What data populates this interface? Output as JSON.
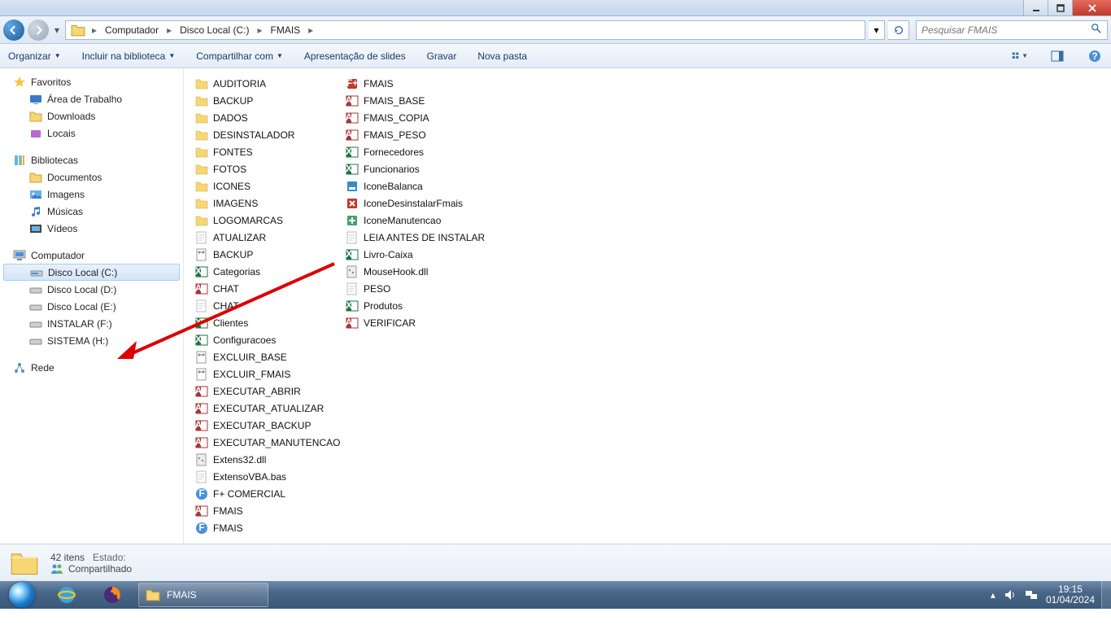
{
  "breadcrumb": {
    "p1": "Computador",
    "p2": "Disco Local (C:)",
    "p3": "FMAIS"
  },
  "search": {
    "placeholder": "Pesquisar FMAIS"
  },
  "toolbar": {
    "organize": "Organizar",
    "include": "Incluir na biblioteca",
    "share": "Compartilhar com",
    "slideshow": "Apresentação de slides",
    "burn": "Gravar",
    "newfolder": "Nova pasta"
  },
  "sidebar": {
    "fav": "Favoritos",
    "desktop": "Área de Trabalho",
    "downloads": "Downloads",
    "places": "Locais",
    "libs": "Bibliotecas",
    "docs": "Documentos",
    "imgs": "Imagens",
    "music": "Músicas",
    "videos": "Vídeos",
    "computer": "Computador",
    "c": "Disco Local (C:)",
    "d": "Disco Local (D:)",
    "e": "Disco Local (E:)",
    "f": "INSTALAR (F:)",
    "h": "SISTEMA (H:)",
    "network": "Rede"
  },
  "col1": [
    {
      "n": "AUDITORIA",
      "i": "folder"
    },
    {
      "n": "BACKUP",
      "i": "folder"
    },
    {
      "n": "DADOS",
      "i": "folder"
    },
    {
      "n": "DESINSTALADOR",
      "i": "folder"
    },
    {
      "n": "FONTES",
      "i": "folder"
    },
    {
      "n": "FOTOS",
      "i": "folder"
    },
    {
      "n": "ICONES",
      "i": "folder"
    },
    {
      "n": "IMAGENS",
      "i": "folder"
    },
    {
      "n": "LOGOMARCAS",
      "i": "folder"
    },
    {
      "n": "ATUALIZAR",
      "i": "doc"
    },
    {
      "n": "BACKUP",
      "i": "bat"
    },
    {
      "n": "Categorias",
      "i": "excel"
    },
    {
      "n": "CHAT",
      "i": "access"
    },
    {
      "n": "CHAT",
      "i": "doc"
    },
    {
      "n": "Clientes",
      "i": "excel"
    },
    {
      "n": "Configuracoes",
      "i": "excel"
    },
    {
      "n": "EXCLUIR_BASE",
      "i": "bat"
    },
    {
      "n": "EXCLUIR_FMAIS",
      "i": "bat"
    },
    {
      "n": "EXECUTAR_ABRIR",
      "i": "access"
    },
    {
      "n": "EXECUTAR_ATUALIZAR",
      "i": "access"
    },
    {
      "n": "EXECUTAR_BACKUP",
      "i": "access"
    },
    {
      "n": "EXECUTAR_MANUTENCAO",
      "i": "access"
    },
    {
      "n": "Extens32.dll",
      "i": "dll"
    },
    {
      "n": "ExtensoVBA.bas",
      "i": "doc"
    },
    {
      "n": "F+ COMERCIAL",
      "i": "app"
    },
    {
      "n": "FMAIS",
      "i": "access"
    },
    {
      "n": "FMAIS",
      "i": "app"
    }
  ],
  "col2": [
    {
      "n": "FMAIS",
      "i": "appred"
    },
    {
      "n": "FMAIS_BASE",
      "i": "access"
    },
    {
      "n": "FMAIS_COPIA",
      "i": "access"
    },
    {
      "n": "FMAIS_PESO",
      "i": "access"
    },
    {
      "n": "Fornecedores",
      "i": "excel"
    },
    {
      "n": "Funcionarios",
      "i": "excel"
    },
    {
      "n": "IconeBalanca",
      "i": "ico1"
    },
    {
      "n": "IconeDesinstalarFmais",
      "i": "ico2"
    },
    {
      "n": "IconeManutencao",
      "i": "ico3"
    },
    {
      "n": "LEIA ANTES DE INSTALAR",
      "i": "doc"
    },
    {
      "n": "Livro-Caixa",
      "i": "excel"
    },
    {
      "n": "MouseHook.dll",
      "i": "dll"
    },
    {
      "n": "PESO",
      "i": "doc"
    },
    {
      "n": "Produtos",
      "i": "excel"
    },
    {
      "n": "VERIFICAR",
      "i": "access"
    }
  ],
  "status": {
    "count": "42 itens",
    "statelbl": "Estado:",
    "shared": "Compartilhado"
  },
  "taskbar": {
    "task": "FMAIS",
    "time": "19:15",
    "date": "01/04/2024"
  }
}
